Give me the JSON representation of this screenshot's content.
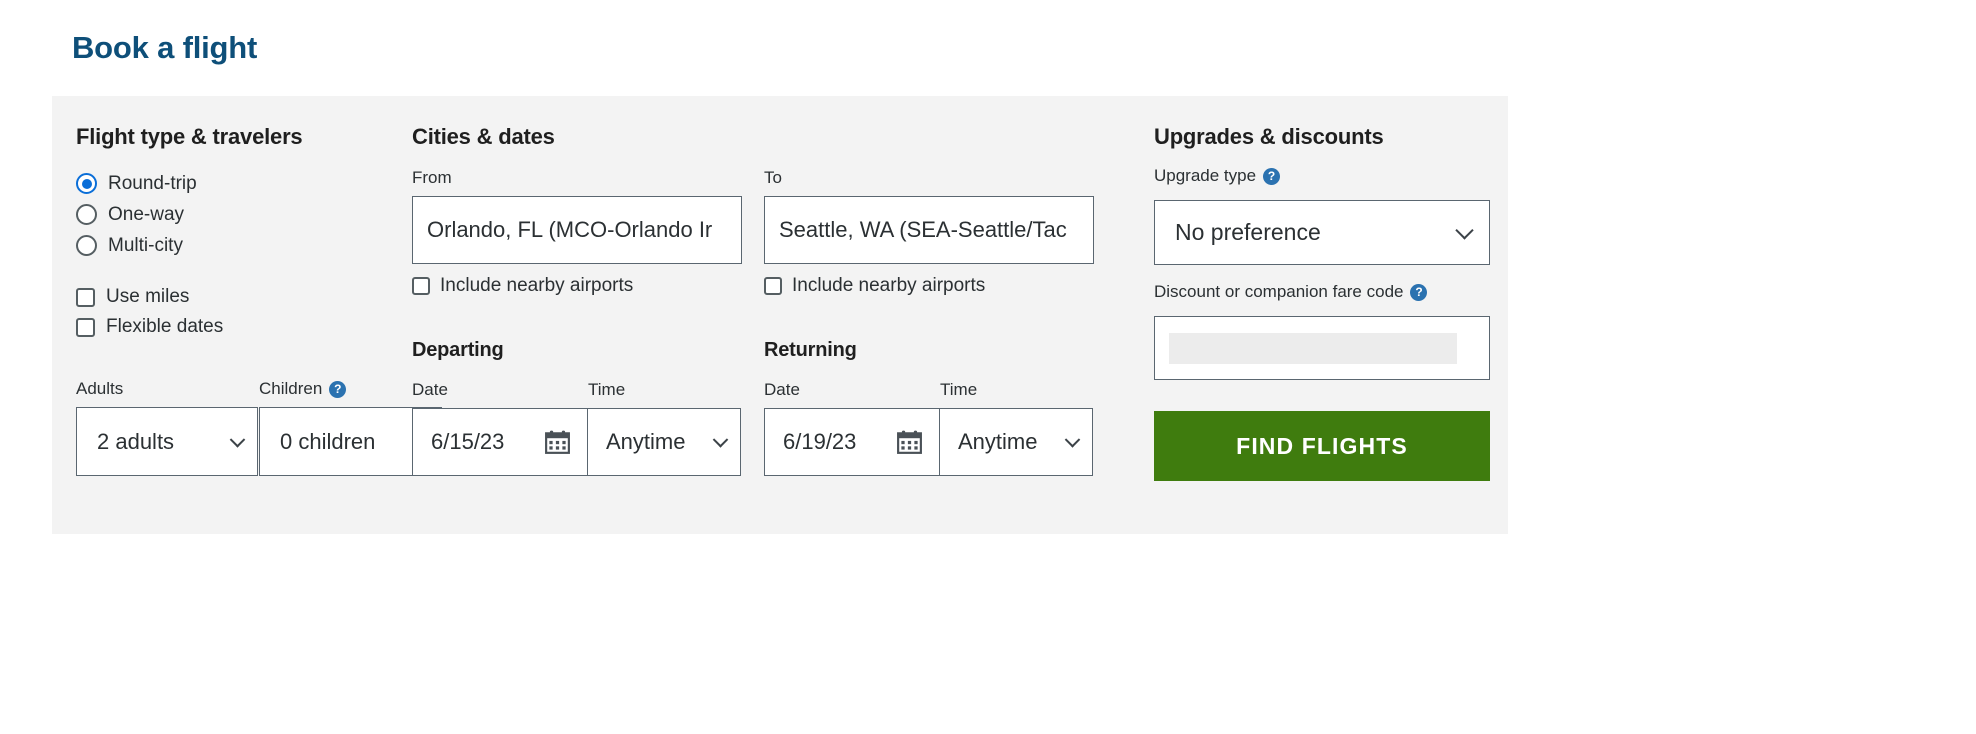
{
  "page": {
    "title": "Book a flight"
  },
  "flight_type_travelers": {
    "heading": "Flight type & travelers",
    "trip_types": [
      {
        "label": "Round-trip",
        "selected": true
      },
      {
        "label": "One-way",
        "selected": false
      },
      {
        "label": "Multi-city",
        "selected": false
      }
    ],
    "options": [
      {
        "label": "Use miles",
        "checked": false
      },
      {
        "label": "Flexible dates",
        "checked": false
      }
    ],
    "adults": {
      "label": "Adults",
      "value": "2 adults"
    },
    "children": {
      "label": "Children",
      "value": "0 children",
      "help_icon": "question-mark-icon"
    }
  },
  "cities_dates": {
    "heading": "Cities & dates",
    "from": {
      "label": "From",
      "value": "Orlando, FL (MCO-Orlando Ir",
      "nearby_label": "Include nearby airports",
      "nearby_checked": false
    },
    "to": {
      "label": "To",
      "value": "Seattle, WA (SEA-Seattle/Tac",
      "nearby_label": "Include nearby airports",
      "nearby_checked": false
    },
    "departing": {
      "heading": "Departing",
      "date_label": "Date",
      "date_value": "6/15/23",
      "time_label": "Time",
      "time_value": "Anytime",
      "calendar_icon": "calendar-icon"
    },
    "returning": {
      "heading": "Returning",
      "date_label": "Date",
      "date_value": "6/19/23",
      "time_label": "Time",
      "time_value": "Anytime",
      "calendar_icon": "calendar-icon"
    }
  },
  "upgrades_discounts": {
    "heading": "Upgrades & discounts",
    "upgrade_type": {
      "label": "Upgrade type",
      "value": "No preference",
      "help_icon": "question-mark-icon"
    },
    "discount": {
      "label": "Discount or companion fare code",
      "value": "",
      "help_icon": "question-mark-icon"
    },
    "submit_label": "FIND FLIGHTS"
  },
  "colors": {
    "title_blue": "#0e4f79",
    "accent_blue": "#0a6ed8",
    "help_blue": "#2b72b0",
    "submit_green": "#3f7c0e",
    "panel_gray": "#f3f3f3",
    "border_gray": "#5a6670"
  }
}
